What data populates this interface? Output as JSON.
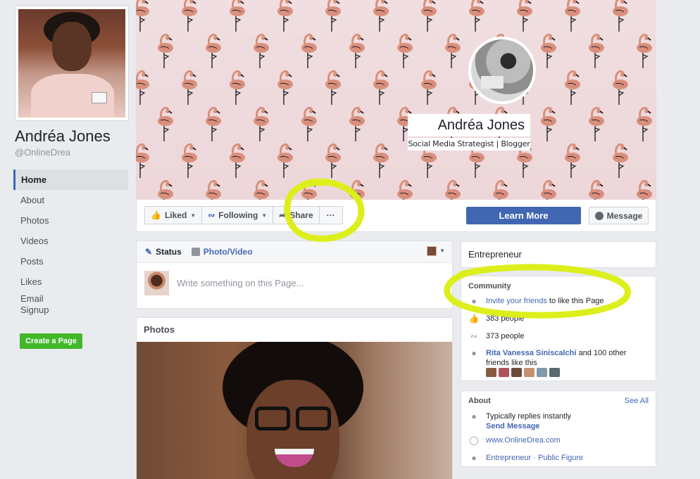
{
  "page": {
    "name": "Andréa Jones",
    "handle": "@OnlineDrea"
  },
  "nav": {
    "items": [
      {
        "label": "Home",
        "active": true
      },
      {
        "label": "About"
      },
      {
        "label": "Photos"
      },
      {
        "label": "Videos"
      },
      {
        "label": "Posts"
      },
      {
        "label": "Likes"
      },
      {
        "label": "Email\nSignup"
      }
    ],
    "create_page": "Create a Page"
  },
  "cover": {
    "name": "Andréa Jones",
    "tagline": "Social Media Strategist | Blogger"
  },
  "actions": {
    "liked": "Liked",
    "following": "Following",
    "share": "Share",
    "more": "···",
    "learn_more": "Learn More",
    "message": "Message"
  },
  "composer": {
    "status": "Status",
    "photo_video": "Photo/Video",
    "placeholder": "Write something on this Page..."
  },
  "photos": {
    "title": "Photos"
  },
  "sidebar": {
    "category": "Entrepreneur",
    "community": {
      "title": "Community",
      "invite_link": "Invite your friends",
      "invite_rest": "to like this Page",
      "likes": "383 people",
      "follows": "373 people",
      "friend_link": "Rita Vanessa Siniscalchi",
      "friend_rest": "and 100 other friends like this"
    },
    "about": {
      "title": "About",
      "see_all": "See All",
      "reply": "Typically replies instantly",
      "send_message": "Send Message",
      "website": "www.OnlineDrea.com",
      "categories": "Entrepreneur · Public Figure"
    }
  },
  "colors": {
    "facebook_blue": "#4267b2",
    "create_green": "#42b72a",
    "highlighter": "#dcef1c",
    "background": "#e9ebee"
  },
  "icons": [
    "thumbs-up-icon",
    "rss-icon",
    "share-arrow-icon",
    "messenger-icon",
    "pencil-icon",
    "camera-icon",
    "globe-icon",
    "chevron-down-icon"
  ]
}
